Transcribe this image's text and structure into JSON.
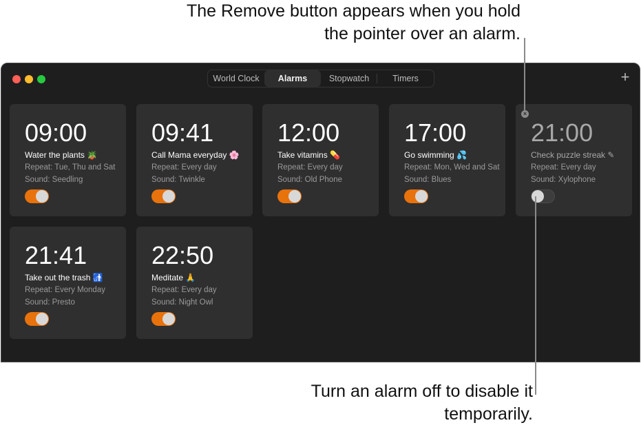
{
  "callouts": {
    "top": "The Remove button appears when you hold the pointer over an alarm.",
    "bottom": "Turn an alarm off to disable it temporarily."
  },
  "window": {
    "tabs": [
      {
        "label": "World Clock",
        "active": false
      },
      {
        "label": "Alarms",
        "active": true
      },
      {
        "label": "Stopwatch",
        "active": false
      },
      {
        "label": "Timers",
        "active": false
      }
    ],
    "add_icon": "+",
    "remove_icon": "×"
  },
  "colors": {
    "accent": "#e8720c",
    "window_bg": "#1e1e1e",
    "card_bg": "#2f2f2f"
  },
  "alarms": [
    {
      "time": "09:00",
      "label": "Water the plants 🪴",
      "repeat": "Repeat: Tue, Thu and Sat",
      "sound": "Sound: Seedling",
      "enabled": true
    },
    {
      "time": "09:41",
      "label": "Call Mama everyday 🌸",
      "repeat": "Repeat: Every day",
      "sound": "Sound: Twinkle",
      "enabled": true
    },
    {
      "time": "12:00",
      "label": "Take vitamins 💊",
      "repeat": "Repeat: Every day",
      "sound": "Sound: Old Phone",
      "enabled": true
    },
    {
      "time": "17:00",
      "label": "Go swimming 💦",
      "repeat": "Repeat: Mon, Wed and Sat",
      "sound": "Sound: Blues",
      "enabled": true
    },
    {
      "time": "21:00",
      "label": "Check puzzle streak ✎",
      "repeat": "Repeat: Every day",
      "sound": "Sound: Xylophone",
      "enabled": false,
      "hovered": true
    },
    {
      "time": "21:41",
      "label": "Take out the trash 🚮",
      "repeat": "Repeat: Every Monday",
      "sound": "Sound: Presto",
      "enabled": true
    },
    {
      "time": "22:50",
      "label": "Meditate 🙏",
      "repeat": "Repeat: Every day",
      "sound": "Sound: Night Owl",
      "enabled": true
    }
  ]
}
